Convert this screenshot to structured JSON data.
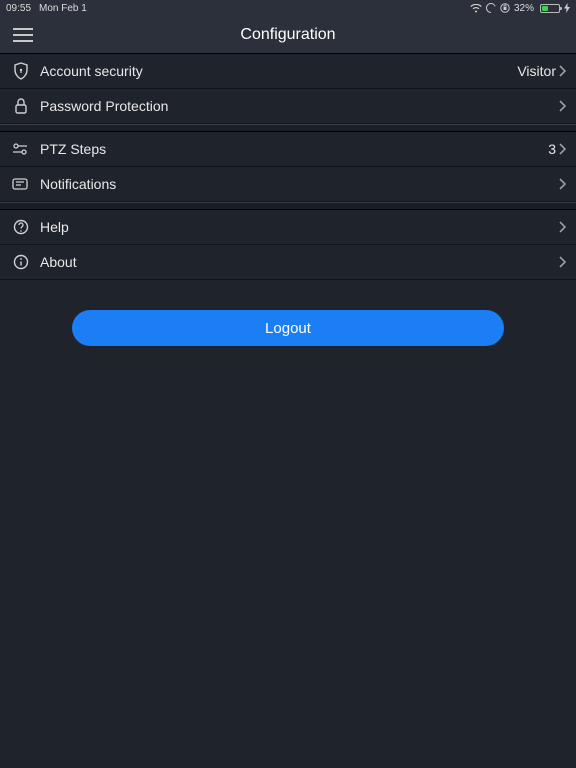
{
  "status_bar": {
    "time": "09:55",
    "date": "Mon Feb 1",
    "battery_percent": "32%"
  },
  "nav": {
    "title": "Configuration"
  },
  "rows": {
    "account_security": {
      "label": "Account security",
      "value": "Visitor"
    },
    "password_protection": {
      "label": "Password Protection"
    },
    "ptz_steps": {
      "label": "PTZ Steps",
      "value": "3"
    },
    "notifications": {
      "label": "Notifications"
    },
    "help": {
      "label": "Help"
    },
    "about": {
      "label": "About"
    }
  },
  "logout": {
    "label": "Logout"
  }
}
